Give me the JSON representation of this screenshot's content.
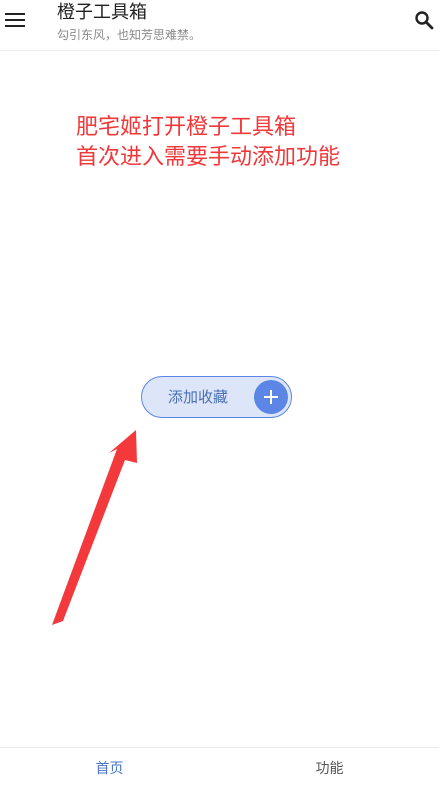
{
  "app_bar": {
    "title": "橙子工具箱",
    "subtitle": "勾引东风，也知芳思难禁。",
    "menu_icon": "menu-icon",
    "search_icon": "search-icon"
  },
  "annotation": {
    "line1": "肥宅姬打开橙子工具箱",
    "line2": "首次进入需要手动添加功能",
    "color": "#f0383a"
  },
  "add_favorite": {
    "label": "添加收藏",
    "icon": "plus-icon",
    "accent": "#5b86e6"
  },
  "bottom_nav": {
    "tabs": [
      {
        "label": "首页",
        "active": true
      },
      {
        "label": "功能",
        "active": false
      }
    ]
  }
}
